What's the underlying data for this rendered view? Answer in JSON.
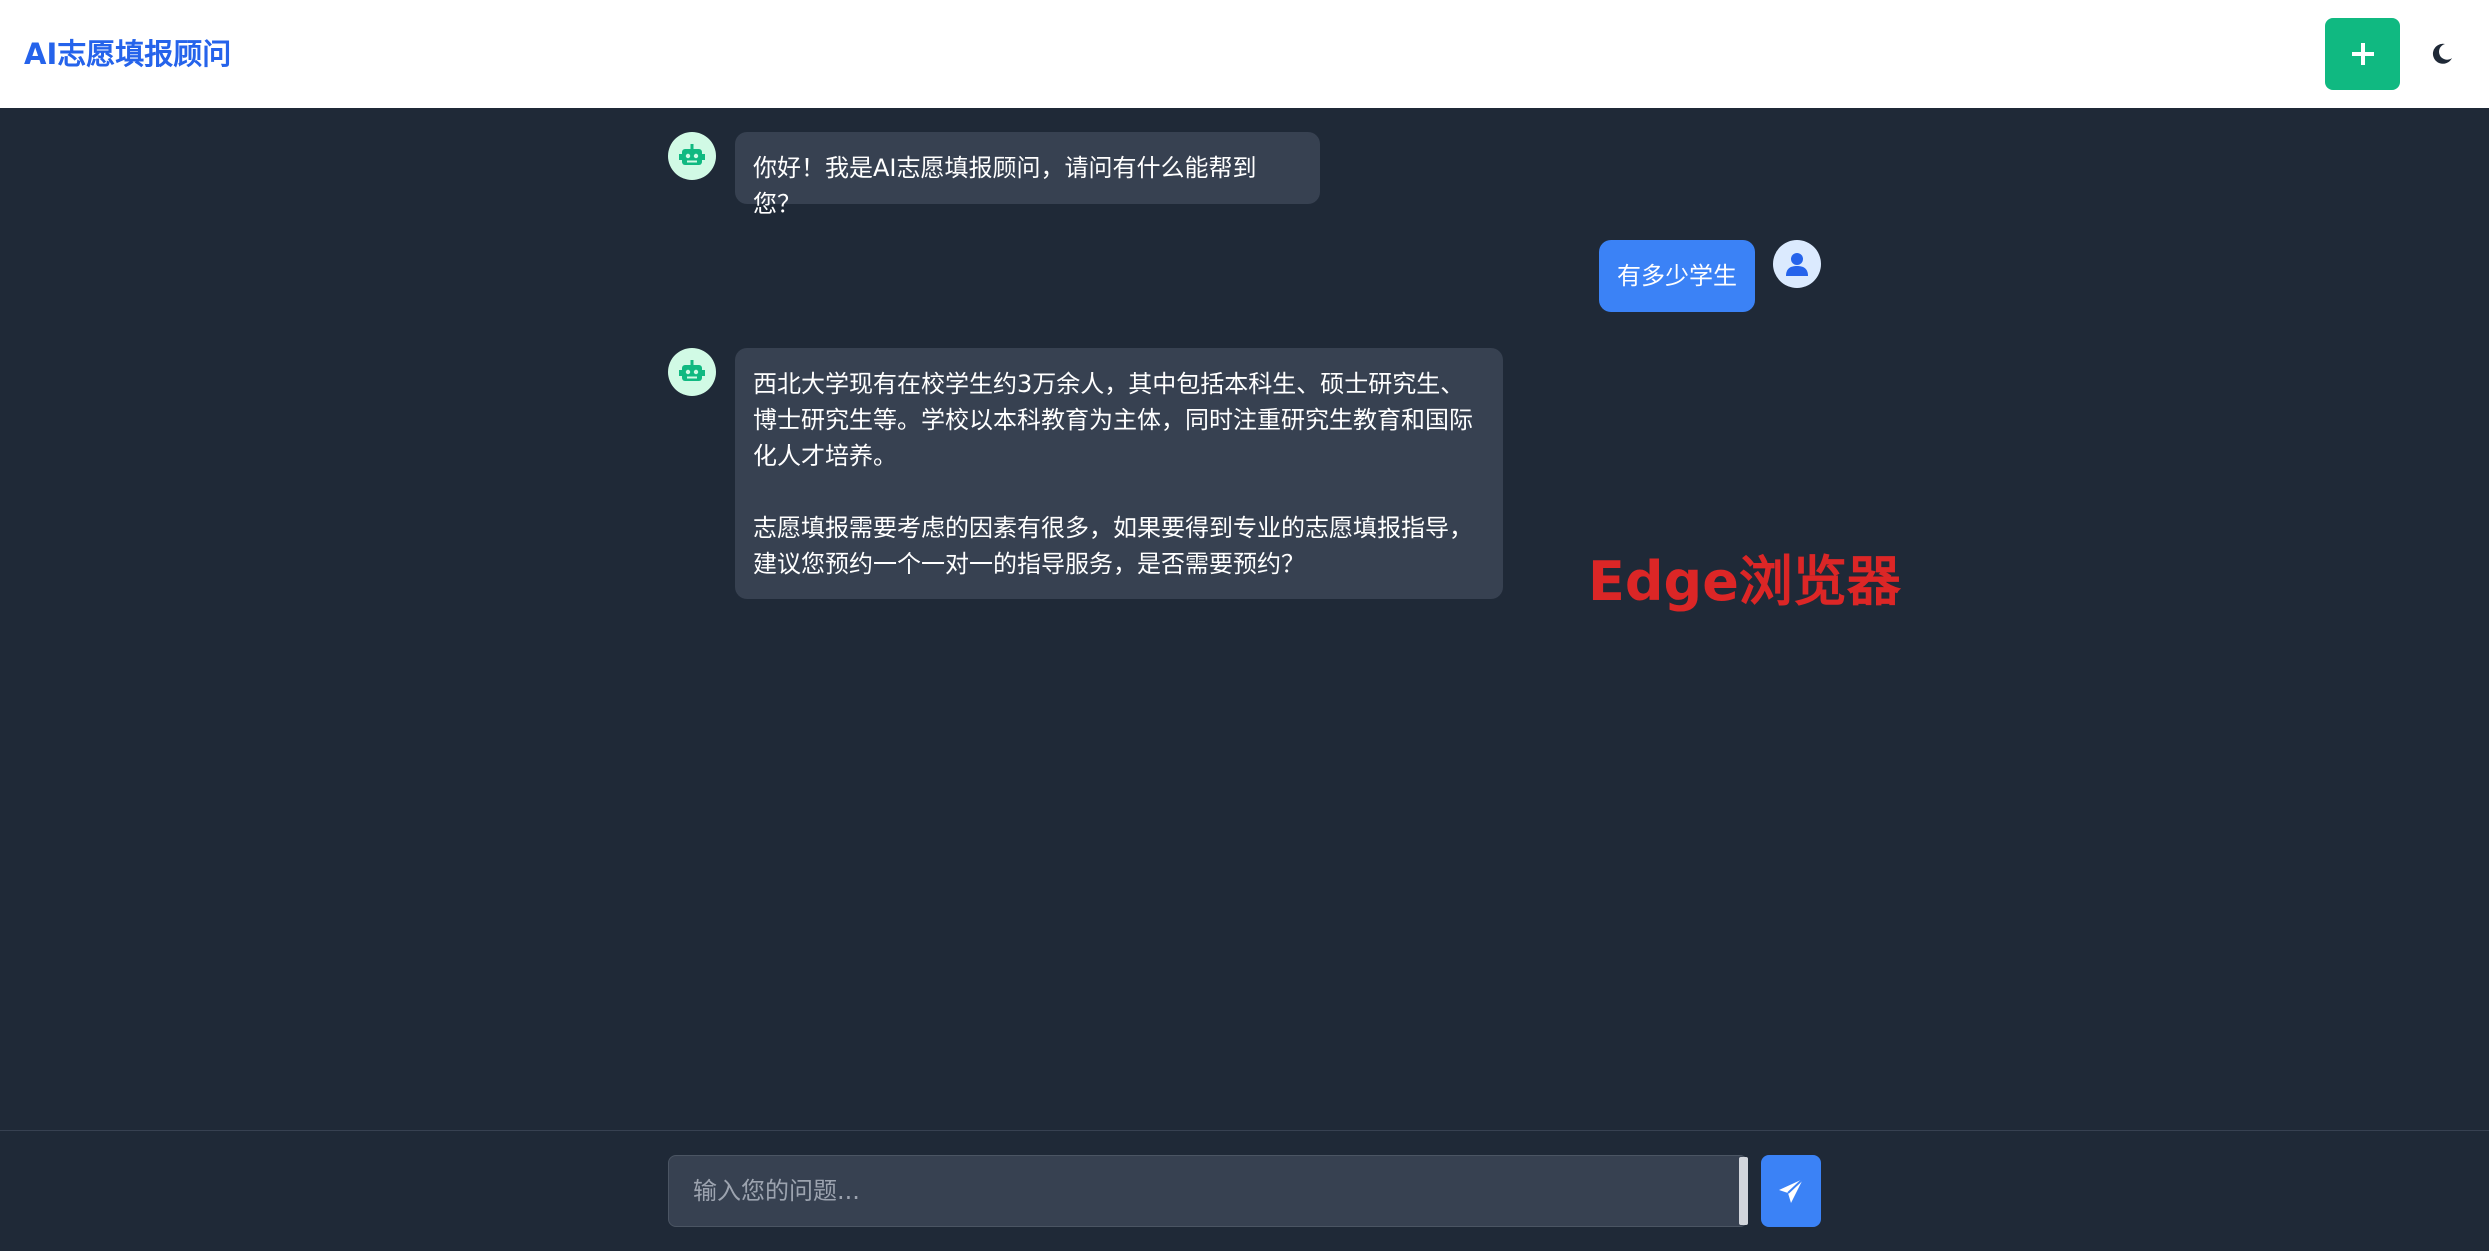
{
  "header": {
    "title": "AI志愿填报顾问",
    "new_chat_icon": "plus-icon",
    "theme_icon": "moon-icon"
  },
  "messages": [
    {
      "role": "bot",
      "text": "你好！我是AI志愿填报顾问，请问有什么能帮到您？"
    },
    {
      "role": "user",
      "text": "有多少学生"
    },
    {
      "role": "bot",
      "paragraphs": [
        "西北大学现有在校学生约3万余人，其中包括本科生、硕士研究生、\n博士研究生等。学校以本科教育为主体，同时注重研究生教育和国际\n化人才培养。",
        "志愿填报需要考虑的因素有很多，如果要得到专业的志愿填报指导，\n建议您预约一个一对一的指导服务，是否需要预约？"
      ]
    }
  ],
  "watermark": "Edge浏览器",
  "input": {
    "placeholder": "输入您的问题..."
  },
  "colors": {
    "brand": "#2563eb",
    "new_chat": "#10b981",
    "send": "#3b82f6",
    "background": "#1f2937",
    "bot_bubble": "#374151",
    "watermark": "#dc2626"
  }
}
